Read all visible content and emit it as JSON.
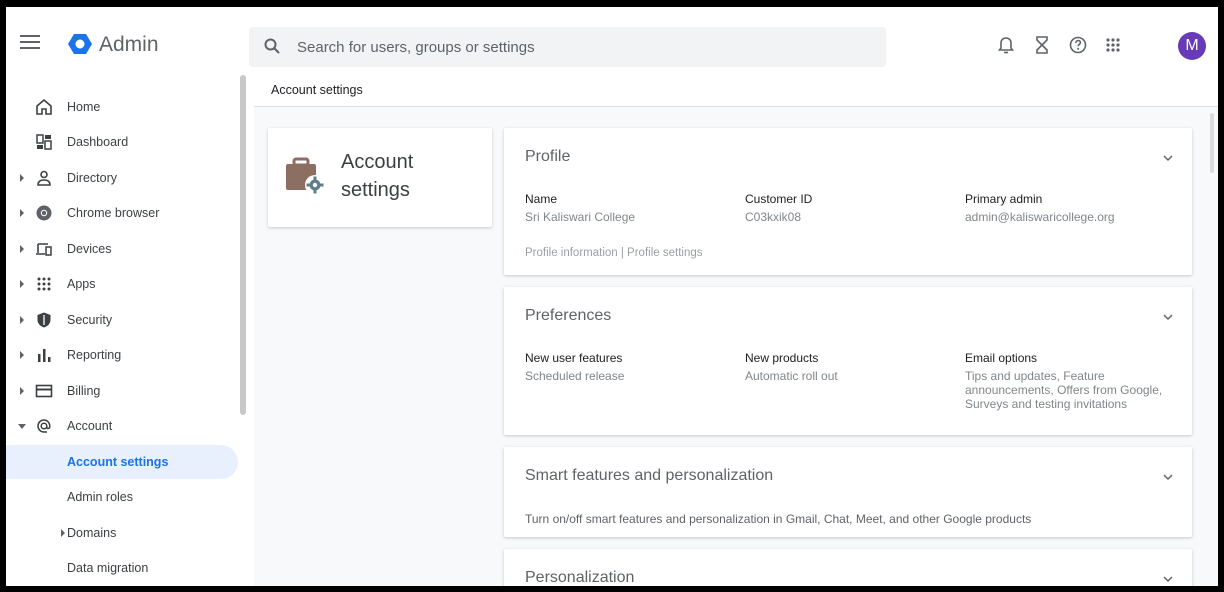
{
  "header": {
    "brand": "Admin",
    "search_placeholder": "Search for users, groups or settings",
    "avatar_letter": "M"
  },
  "sidebar": {
    "items": [
      {
        "label": "Home",
        "icon": "home-icon"
      },
      {
        "label": "Dashboard",
        "icon": "dashboard-icon"
      },
      {
        "label": "Directory",
        "icon": "person-icon"
      },
      {
        "label": "Chrome browser",
        "icon": "chrome-icon"
      },
      {
        "label": "Devices",
        "icon": "devices-icon"
      },
      {
        "label": "Apps",
        "icon": "apps-grid-icon"
      },
      {
        "label": "Security",
        "icon": "shield-icon"
      },
      {
        "label": "Reporting",
        "icon": "bar-chart-icon"
      },
      {
        "label": "Billing",
        "icon": "credit-card-icon"
      },
      {
        "label": "Account",
        "icon": "at-sign-icon"
      }
    ],
    "sub_items": [
      {
        "label": "Account settings"
      },
      {
        "label": "Admin roles"
      },
      {
        "label": "Domains"
      },
      {
        "label": "Data migration"
      }
    ]
  },
  "breadcrumb": "Account settings",
  "title_card": {
    "line1": "Account",
    "line2": "settings"
  },
  "profile": {
    "title": "Profile",
    "name_label": "Name",
    "name_value": "Sri Kaliswari College",
    "customer_label": "Customer ID",
    "customer_value": "C03kxik08",
    "admin_label": "Primary admin",
    "admin_value": "admin@kaliswaricollege.org",
    "links": "Profile information | Profile settings"
  },
  "preferences": {
    "title": "Preferences",
    "features_label": "New user features",
    "features_value": "Scheduled release",
    "products_label": "New products",
    "products_value": "Automatic roll out",
    "email_label": "Email options",
    "email_value": "Tips and updates, Feature announcements, Offers from Google, Surveys and testing invitations"
  },
  "smart": {
    "title": "Smart features and personalization",
    "desc": "Turn on/off smart features and personalization in Gmail, Chat, Meet, and other Google products"
  },
  "personalization": {
    "title": "Personalization"
  },
  "colors": {
    "accent": "#1a73e8",
    "active_bg": "#e8f0fe",
    "avatar": "#673ab7",
    "briefcase": "#8d6e63"
  }
}
